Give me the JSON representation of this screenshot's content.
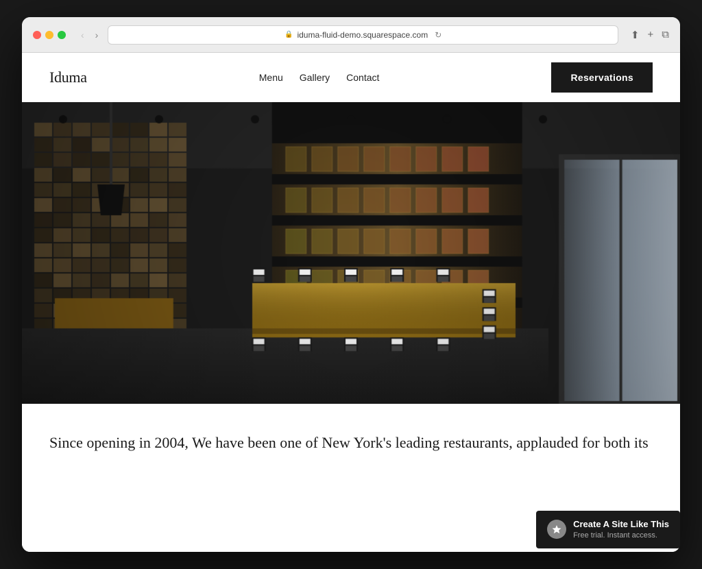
{
  "browser": {
    "url": "iduma-fluid-demo.squarespace.com",
    "back_disabled": true,
    "forward_disabled": false
  },
  "nav": {
    "logo": "Iduma",
    "links": [
      {
        "label": "Menu",
        "href": "#"
      },
      {
        "label": "Gallery",
        "href": "#"
      },
      {
        "label": "Contact",
        "href": "#"
      }
    ],
    "cta_label": "Reservations"
  },
  "hero": {
    "alt": "Restaurant interior with wine storage and dining tables"
  },
  "body_text": "Since opening in 2004, We have been one of New York's leading restaurants, applauded for both its",
  "badge": {
    "title": "Create A Site Like This",
    "subtitle": "Free trial. Instant access."
  }
}
